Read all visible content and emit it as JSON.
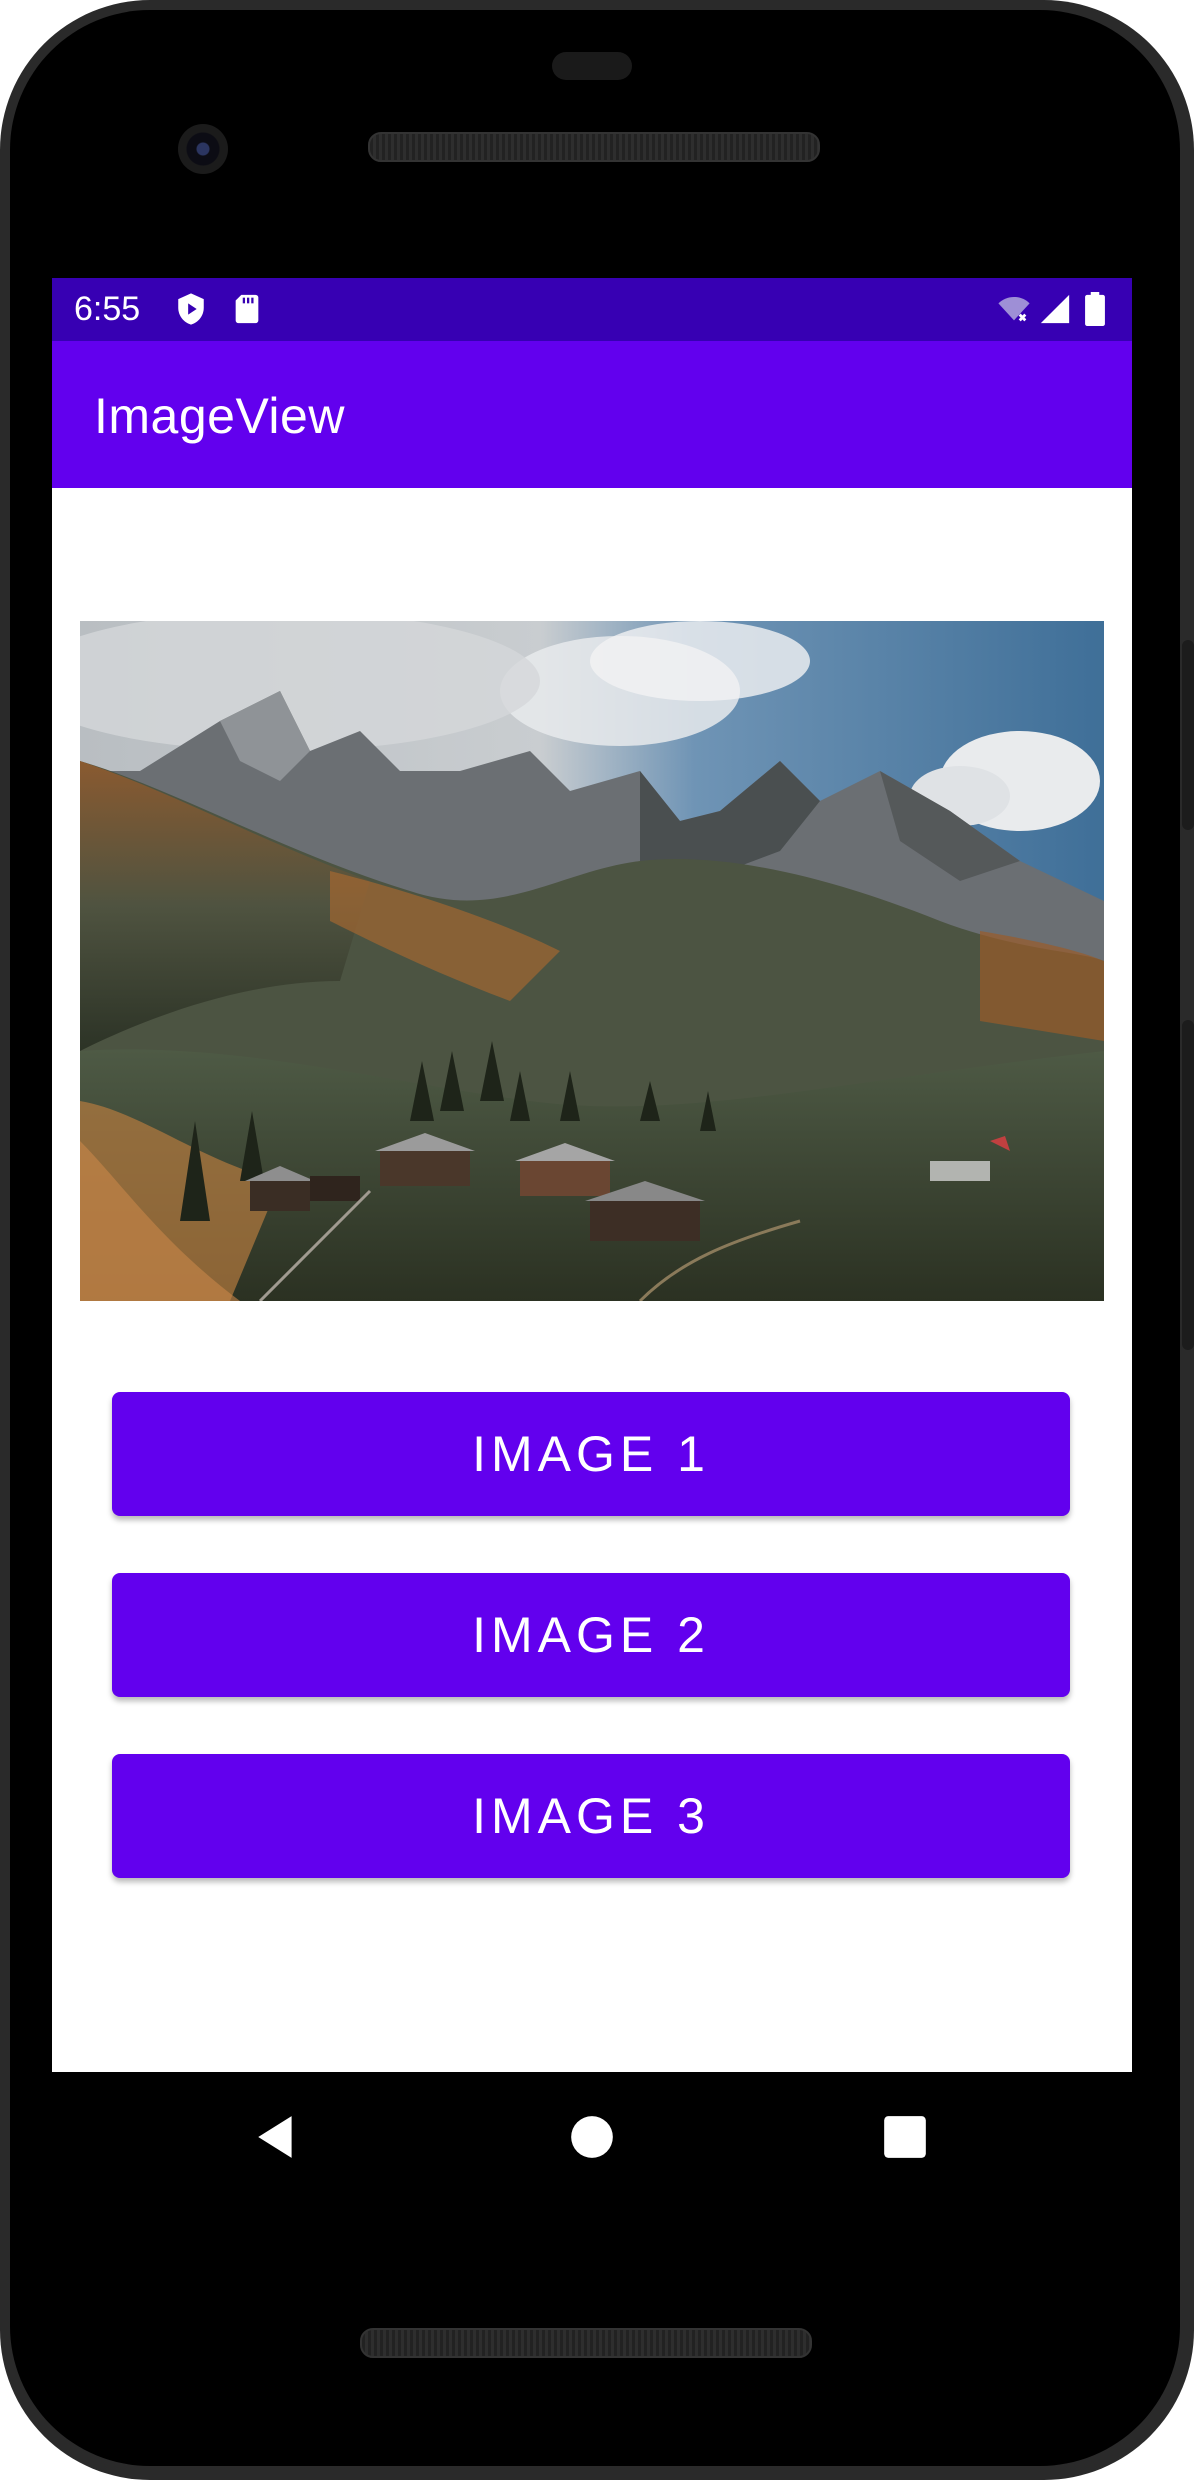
{
  "status_bar": {
    "time": "6:55",
    "left_icons": [
      "shield-play-icon",
      "sd-card-icon"
    ],
    "right_icons": [
      "wifi-off-icon",
      "signal-icon",
      "battery-icon"
    ]
  },
  "app_bar": {
    "title": "ImageView"
  },
  "image_view": {
    "description_icon": "landscape-image"
  },
  "buttons": [
    {
      "label": "IMAGE 1"
    },
    {
      "label": "IMAGE 2"
    },
    {
      "label": "IMAGE 3"
    }
  ],
  "nav_bar": {
    "icons": [
      "back-icon",
      "home-icon",
      "recents-icon"
    ]
  },
  "colors": {
    "primary": "#6200ee",
    "primary_dark": "#3700b3",
    "on_primary": "#ffffff",
    "background": "#ffffff"
  }
}
